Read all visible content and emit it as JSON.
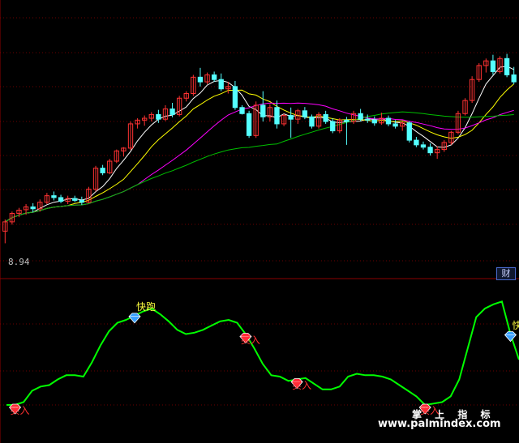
{
  "price_axis_label": "8.94",
  "badge_text": "财",
  "watermark": {
    "chinese": "掌 上 指 标",
    "url": "www.palmindex.com"
  },
  "colors": {
    "background": "#000000",
    "up_candle": "#ff3232",
    "down_candle": "#54ffff",
    "ma_white": "#ffffff",
    "ma_yellow": "#ffff00",
    "ma_magenta": "#ff00ff",
    "ma_green": "#00c000",
    "indicator_line": "#00ff00",
    "grid": "#6b0000"
  },
  "chart_data": [
    {
      "type": "candlestick",
      "candles": [
        [
          9.2,
          9.45,
          8.94,
          9.4
        ],
        [
          9.4,
          9.62,
          9.34,
          9.58
        ],
        [
          9.58,
          9.7,
          9.5,
          9.65
        ],
        [
          9.66,
          9.78,
          9.55,
          9.72
        ],
        [
          9.72,
          9.8,
          9.6,
          9.68
        ],
        [
          9.68,
          9.88,
          9.62,
          9.82
        ],
        [
          9.82,
          10.02,
          9.78,
          9.96
        ],
        [
          9.96,
          10.05,
          9.86,
          9.92
        ],
        [
          9.92,
          9.98,
          9.8,
          9.84
        ],
        [
          9.84,
          9.96,
          9.78,
          9.9
        ],
        [
          9.9,
          9.96,
          9.82,
          9.86
        ],
        [
          9.86,
          9.94,
          9.76,
          9.82
        ],
        [
          9.82,
          10.15,
          9.8,
          10.1
        ],
        [
          10.1,
          10.6,
          10.05,
          10.55
        ],
        [
          10.55,
          10.62,
          10.4,
          10.45
        ],
        [
          10.45,
          10.75,
          10.42,
          10.7
        ],
        [
          10.7,
          10.95,
          10.66,
          10.92
        ],
        [
          10.92,
          11.0,
          10.8,
          10.98
        ],
        [
          10.98,
          11.55,
          10.94,
          11.5
        ],
        [
          11.5,
          11.62,
          11.4,
          11.58
        ],
        [
          11.58,
          11.68,
          11.46,
          11.62
        ],
        [
          11.62,
          11.75,
          11.55,
          11.7
        ],
        [
          11.7,
          11.8,
          11.52,
          11.6
        ],
        [
          11.6,
          11.9,
          11.56,
          11.82
        ],
        [
          11.82,
          11.95,
          11.64,
          11.7
        ],
        [
          11.7,
          12.1,
          11.66,
          12.05
        ],
        [
          12.05,
          12.2,
          11.98,
          12.15
        ],
        [
          12.15,
          12.55,
          12.1,
          12.5
        ],
        [
          12.5,
          12.7,
          12.3,
          12.4
        ],
        [
          12.4,
          12.6,
          12.35,
          12.55
        ],
        [
          12.55,
          12.62,
          12.4,
          12.45
        ],
        [
          12.45,
          12.58,
          12.2,
          12.25
        ],
        [
          12.25,
          12.4,
          12.15,
          12.3
        ],
        [
          12.3,
          12.42,
          11.8,
          11.85
        ],
        [
          11.85,
          11.9,
          11.7,
          11.72
        ],
        [
          11.72,
          11.78,
          11.2,
          11.25
        ],
        [
          11.25,
          11.98,
          11.2,
          11.9
        ],
        [
          11.9,
          12.2,
          11.55,
          11.65
        ],
        [
          11.65,
          11.92,
          11.55,
          11.85
        ],
        [
          11.85,
          12.0,
          11.4,
          11.5
        ],
        [
          11.5,
          11.72,
          11.45,
          11.68
        ],
        [
          11.68,
          11.85,
          11.2,
          11.6
        ],
        [
          11.6,
          11.82,
          11.5,
          11.78
        ],
        [
          11.78,
          11.86,
          11.6,
          11.65
        ],
        [
          11.65,
          11.7,
          11.4,
          11.45
        ],
        [
          11.45,
          11.75,
          11.4,
          11.7
        ],
        [
          11.7,
          11.78,
          11.5,
          11.55
        ],
        [
          11.55,
          11.62,
          11.3,
          11.35
        ],
        [
          11.35,
          11.62,
          11.3,
          11.58
        ],
        [
          11.58,
          11.65,
          11.05,
          11.55
        ],
        [
          11.55,
          11.78,
          11.5,
          11.72
        ],
        [
          11.72,
          11.82,
          11.55,
          11.6
        ],
        [
          11.6,
          11.7,
          11.52,
          11.58
        ],
        [
          11.58,
          11.66,
          11.46,
          11.52
        ],
        [
          11.52,
          11.74,
          11.48,
          11.62
        ],
        [
          11.62,
          11.68,
          11.45,
          11.5
        ],
        [
          11.5,
          11.58,
          11.4,
          11.45
        ],
        [
          11.45,
          11.55,
          11.35,
          11.52
        ],
        [
          11.52,
          11.56,
          11.1,
          11.15
        ],
        [
          11.15,
          11.22,
          11.0,
          11.05
        ],
        [
          11.05,
          11.12,
          10.95,
          11.0
        ],
        [
          11.0,
          11.08,
          10.82,
          10.88
        ],
        [
          10.88,
          11.02,
          10.75,
          10.95
        ],
        [
          10.95,
          11.15,
          10.9,
          11.1
        ],
        [
          11.1,
          11.35,
          11.05,
          11.32
        ],
        [
          11.32,
          11.78,
          11.28,
          11.72
        ],
        [
          11.72,
          12.05,
          11.68,
          12.0
        ],
        [
          12.0,
          12.52,
          11.95,
          12.45
        ],
        [
          12.45,
          12.8,
          12.4,
          12.75
        ],
        [
          12.75,
          12.9,
          12.6,
          12.85
        ],
        [
          12.85,
          12.98,
          12.55,
          12.62
        ],
        [
          12.62,
          12.95,
          12.58,
          12.9
        ],
        [
          12.9,
          13.0,
          12.5,
          12.55
        ],
        [
          12.55,
          12.72,
          12.35,
          12.4
        ]
      ],
      "ymin": 8.6,
      "ymax": 13.2
    },
    {
      "type": "line",
      "series": [
        {
          "values": [
            20,
            20,
            22,
            30,
            33,
            34,
            38,
            41,
            41,
            40,
            50,
            62,
            72,
            78,
            80,
            83,
            86,
            88,
            84,
            79,
            73,
            70,
            71,
            73,
            76,
            79,
            80,
            78,
            70,
            60,
            49,
            41,
            40,
            37,
            38,
            39,
            35,
            31,
            31,
            33,
            40,
            42,
            41,
            41,
            40,
            38,
            34,
            30,
            26,
            20,
            21,
            22,
            26,
            38,
            60,
            82,
            88,
            91,
            93,
            70,
            52
          ]
        }
      ],
      "ylim": [
        0,
        100
      ],
      "signals": [
        {
          "index": 1,
          "type": "buy",
          "label": "买入"
        },
        {
          "index": 15,
          "type": "sell",
          "label": "快跑"
        },
        {
          "index": 28,
          "type": "buy",
          "label": "买入"
        },
        {
          "index": 34,
          "type": "buy",
          "label": "买入"
        },
        {
          "index": 49,
          "type": "buy",
          "label": "买入"
        },
        {
          "index": 59,
          "type": "sell",
          "label": "快跑"
        }
      ]
    }
  ]
}
